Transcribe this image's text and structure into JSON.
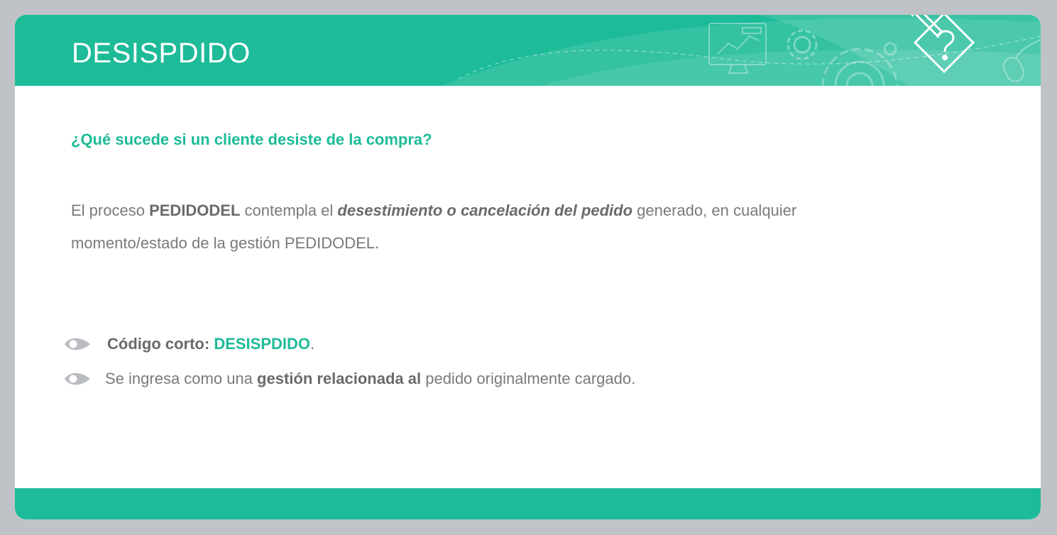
{
  "slide": {
    "title": "DESISPDIDO"
  },
  "content": {
    "question": "¿Qué sucede si un cliente desiste de la compra?",
    "paragraph": {
      "p1": "El proceso ",
      "p2": "PEDIDODEL",
      "p3": " contempla el ",
      "p4": "desestimiento o cancelación del pedido",
      "p5": " generado, en cualquier momento/estado de la gestión PEDIDODEL."
    },
    "bullets": [
      {
        "icon": "eye-bullet-icon",
        "label": "Código corto: ",
        "value": "DESISPDIDO",
        "suffix": "."
      },
      {
        "icon": "eye-bullet-icon",
        "t1": "Se ingresa como una ",
        "t2": "gestión relacionada al",
        "t3": " pedido originalmente cargado."
      }
    ]
  },
  "colors": {
    "accent": "#1dbb98",
    "text": "#7a7a7a",
    "bullet_icon": "#b9bcc0",
    "background": "#bfc3c7"
  }
}
